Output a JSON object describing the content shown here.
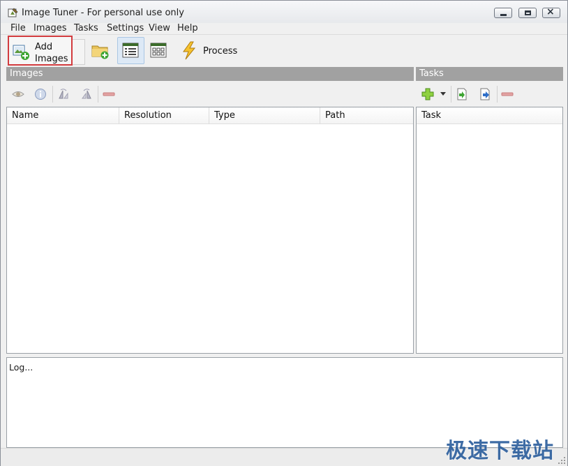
{
  "window": {
    "title": "Image Tuner - For personal use only"
  },
  "menu": [
    "File",
    "Images",
    "Tasks",
    "Settings",
    "View",
    "Help"
  ],
  "toolbar": {
    "add_images_line1": "Add",
    "add_images_line2": "Images",
    "process_label": "Process"
  },
  "images_panel": {
    "title": "Images",
    "columns": [
      "Name",
      "Resolution",
      "Type",
      "Path"
    ]
  },
  "tasks_panel": {
    "title": "Tasks",
    "columns": [
      "Task"
    ]
  },
  "log": {
    "text": "Log..."
  },
  "watermark": "极速下载站",
  "colors": {
    "highlight_border": "#d23b3e",
    "panel_header": "#a1a1a1",
    "active_view_button": "#dde9f6"
  }
}
